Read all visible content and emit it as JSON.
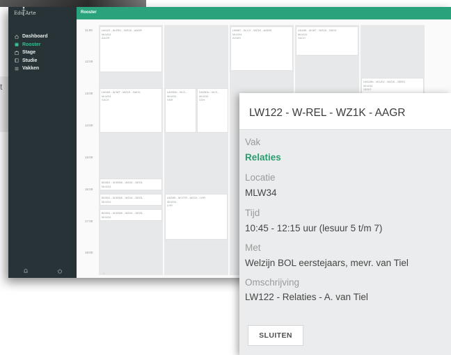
{
  "sidebar": {
    "logo": "Edu Arte",
    "items": [
      {
        "label": "Dashboard",
        "icon": "home-icon",
        "active": false
      },
      {
        "label": "Rooster",
        "icon": "calendar-icon",
        "active": true
      },
      {
        "label": "Stage",
        "icon": "briefcase-icon",
        "active": false
      },
      {
        "label": "Studie",
        "icon": "book-icon",
        "active": false
      },
      {
        "label": "Vakken",
        "icon": "list-icon",
        "active": false
      }
    ],
    "footer_icons": [
      "bell-icon",
      "power-icon"
    ]
  },
  "header": {
    "title": "Rooster"
  },
  "schedule": {
    "times": [
      "11:00",
      "12:00",
      "13:00",
      "14:00",
      "15:00",
      "16:00",
      "17:00",
      "18:00"
    ],
    "events": [
      {
        "lines": [
          "LW122 - W-REL - WZ1K - AAGR",
          "MLW34",
          "AAGR"
        ]
      },
      {
        "lines": [
          "LW057 - W-CV - WZ1K - AGMS",
          "MLW34",
          "AGMS"
        ]
      },
      {
        "lines": [
          "LW165 - W-MT - WZ1K - SACK",
          "MLW34",
          "SACK"
        ]
      },
      {
        "lines": [
          "LW165 - W-MT - WZ1K - SACK",
          "MLW34",
          "SACK"
        ]
      },
      {
        "lines": [
          "LW252b - W-S...",
          "MLW34",
          "SNR"
        ]
      },
      {
        "lines": [
          "LW251b - W-S...",
          "MLW34",
          "VDH"
        ]
      },
      {
        "lines": [
          "LW125b - W-LEV - WZ1K - SERO",
          "MLW34",
          "SERO"
        ]
      },
      {
        "lines": [
          "BO001 - W-BSW - WZ1K - DEOL",
          "MLW34"
        ]
      },
      {
        "lines": [
          "BO001 - W-BSW - WZ1K - DEOL",
          "MLW34"
        ]
      },
      {
        "lines": [
          "BO001 - W-BSW - WZ1K - DEOL",
          "MLW34"
        ]
      },
      {
        "lines": [
          "LW159 - W-VTR - WZ1K - LHR",
          "MLW34",
          "LHR"
        ]
      }
    ],
    "footer": "+"
  },
  "modal": {
    "title": "LW122 - W-REL - WZ1K - AAGR",
    "fields": [
      {
        "label": "Vak",
        "value": "Relaties",
        "accent": true
      },
      {
        "label": "Locatie",
        "value": "MLW34",
        "accent": false
      },
      {
        "label": "Tijd",
        "value": "10:45 - 12:15 uur (lesuur 5 t/m 7)",
        "accent": false
      },
      {
        "label": "Met",
        "value": "Welzijn BOL eerstejaars, mevr. van Tiel",
        "accent": false
      },
      {
        "label": "Omschrijving",
        "value": "LW122 - Relaties - A. van Tiel",
        "accent": false
      }
    ],
    "close_label": "SLUITEN"
  },
  "background": {
    "fragment_text": "t"
  },
  "colors": {
    "sidebar": "#273336",
    "accent": "#2aa27c",
    "accent_text": "#2a9d6e"
  }
}
